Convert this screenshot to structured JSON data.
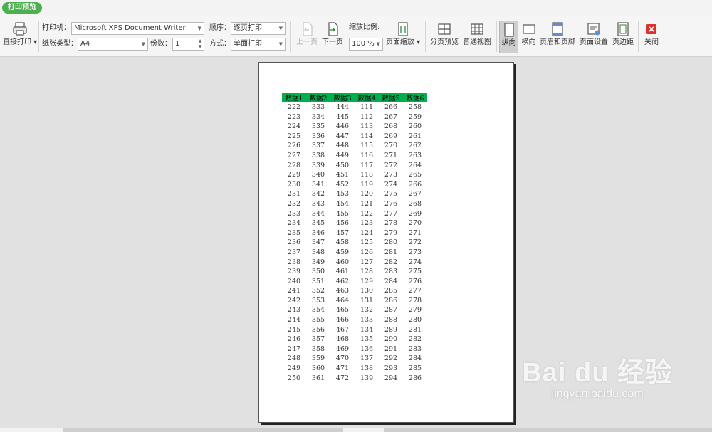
{
  "tab": {
    "label": "打印预览"
  },
  "toolbar": {
    "direct_print": "直接打印",
    "printer_label": "打印机：",
    "printer_value": "Microsoft XPS Document Writer",
    "order_label": "顺序：",
    "order_value": "逐页打印",
    "paper_label": "纸张类型：",
    "paper_value": "A4",
    "copies_label": "份数：",
    "copies_value": "1",
    "mode_label": "方式：",
    "mode_value": "单面打印",
    "prev_page": "上一页",
    "next_page": "下一页",
    "zoom_label": "缩放比例:",
    "zoom_value": "100 %",
    "page_zoom": "页面缩放",
    "page_break_preview": "分页预览",
    "normal_view": "普通视图",
    "portrait": "纵向",
    "landscape": "横向",
    "header_footer": "页眉和页脚",
    "page_setup": "页面设置",
    "margins": "页边距",
    "close": "关闭"
  },
  "table": {
    "headers": [
      "数据1",
      "数据2",
      "数据3",
      "数据4",
      "数据5",
      "数据6"
    ],
    "rows": [
      [
        222,
        333,
        444,
        111,
        266,
        258
      ],
      [
        223,
        334,
        445,
        112,
        267,
        259
      ],
      [
        224,
        335,
        446,
        113,
        268,
        260
      ],
      [
        225,
        336,
        447,
        114,
        269,
        261
      ],
      [
        226,
        337,
        448,
        115,
        270,
        262
      ],
      [
        227,
        338,
        449,
        116,
        271,
        263
      ],
      [
        228,
        339,
        450,
        117,
        272,
        264
      ],
      [
        229,
        340,
        451,
        118,
        273,
        265
      ],
      [
        230,
        341,
        452,
        119,
        274,
        266
      ],
      [
        231,
        342,
        453,
        120,
        275,
        267
      ],
      [
        232,
        343,
        454,
        121,
        276,
        268
      ],
      [
        233,
        344,
        455,
        122,
        277,
        269
      ],
      [
        234,
        345,
        456,
        123,
        278,
        270
      ],
      [
        235,
        346,
        457,
        124,
        279,
        271
      ],
      [
        236,
        347,
        458,
        125,
        280,
        272
      ],
      [
        237,
        348,
        459,
        126,
        281,
        273
      ],
      [
        238,
        349,
        460,
        127,
        282,
        274
      ],
      [
        239,
        350,
        461,
        128,
        283,
        275
      ],
      [
        240,
        351,
        462,
        129,
        284,
        276
      ],
      [
        241,
        352,
        463,
        130,
        285,
        277
      ],
      [
        242,
        353,
        464,
        131,
        286,
        278
      ],
      [
        243,
        354,
        465,
        132,
        287,
        279
      ],
      [
        244,
        355,
        466,
        133,
        288,
        280
      ],
      [
        245,
        356,
        467,
        134,
        289,
        281
      ],
      [
        246,
        357,
        468,
        135,
        290,
        282
      ],
      [
        247,
        358,
        469,
        136,
        291,
        283
      ],
      [
        248,
        359,
        470,
        137,
        292,
        284
      ],
      [
        249,
        360,
        471,
        138,
        293,
        285
      ],
      [
        250,
        361,
        472,
        139,
        294,
        286
      ]
    ]
  },
  "watermark": {
    "logo": "Bai du 经验",
    "url": "jingyan.baidu.com"
  },
  "colors": {
    "accent": "#4caf50",
    "header_fill": "#00b050",
    "close_red": "#d9342b"
  }
}
